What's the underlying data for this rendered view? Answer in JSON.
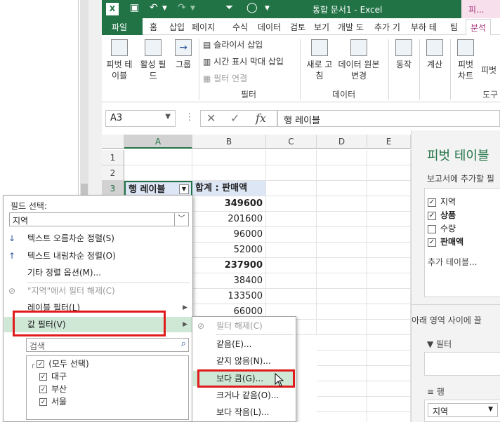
{
  "titlebar": {
    "app_icon": "X",
    "title": "통합 문서1 - Excel",
    "context_tab": "피..."
  },
  "tabs": [
    "파일",
    "홈",
    "삽입",
    "페이지",
    "수식",
    "데이터",
    "검토",
    "보기",
    "개발 도",
    "추가 기",
    "부하 테",
    "팀",
    "분석"
  ],
  "ribbon": {
    "pivot_table": "피벗 테\n이블",
    "active_field": "활성 필\n드",
    "group": "그룹",
    "insert_slicer": "슬라이서 삽입",
    "insert_timeline": "시간 표시 막대 삽입",
    "filter_connections": "필터 연결",
    "filter_group": "필터",
    "refresh": "새로 고\n침",
    "change_source": "데이터 원본\n변경",
    "data_group": "데이터",
    "actions": "동작",
    "calculations": "계산",
    "pivot_chart": "피벗\n차트",
    "pivot2": "피벗",
    "tools_group": "도구"
  },
  "formula_bar": {
    "name_box": "A3",
    "fx": "fx",
    "value": "행 레이블"
  },
  "columns": [
    "A",
    "B",
    "C",
    "D",
    "E"
  ],
  "rows": [
    "1",
    "2",
    "3"
  ],
  "cells": {
    "a3": "행 레이블",
    "b3": "합계 : 판매액",
    "values": [
      "349600",
      "201600",
      "96000",
      "52000",
      "237900",
      "38400",
      "133500",
      "66000"
    ]
  },
  "pivot_pane": {
    "title": "피벗 테이블",
    "subtitle": "보고서에 추가할 필",
    "fields": [
      {
        "label": "지역",
        "checked": true
      },
      {
        "label": "상품",
        "checked": true
      },
      {
        "label": "수량",
        "checked": false
      },
      {
        "label": "판매액",
        "checked": true
      }
    ],
    "more_tables": "추가 테이블...",
    "areas_label": "아래 영역 사이에 끌",
    "filter_label": "필터",
    "rows_label": "행",
    "rows_value": "지역"
  },
  "filter_menu": {
    "field_label": "필드 선택:",
    "field_value": "지역",
    "sort_asc": "텍스트 오름차순 정렬(S)",
    "sort_desc": "텍스트 내림차순 정렬(O)",
    "more_sort": "기타 정렬 옵션(M)...",
    "clear_filter": "\"지역\"에서 필터 해제(C)",
    "label_filter": "레이블 필터(L)",
    "value_filter": "값 필터(V)",
    "search_placeholder": "검색",
    "list": [
      "(모두 선택)",
      "대구",
      "부산",
      "서울"
    ]
  },
  "value_filter_submenu": {
    "clear": "필터 해제(C)",
    "items": [
      "같음(E)...",
      "같지 않음(N)...",
      "보다 큼(G)...",
      "크거나 같음(O)...",
      "보다 작음(L)..."
    ]
  }
}
